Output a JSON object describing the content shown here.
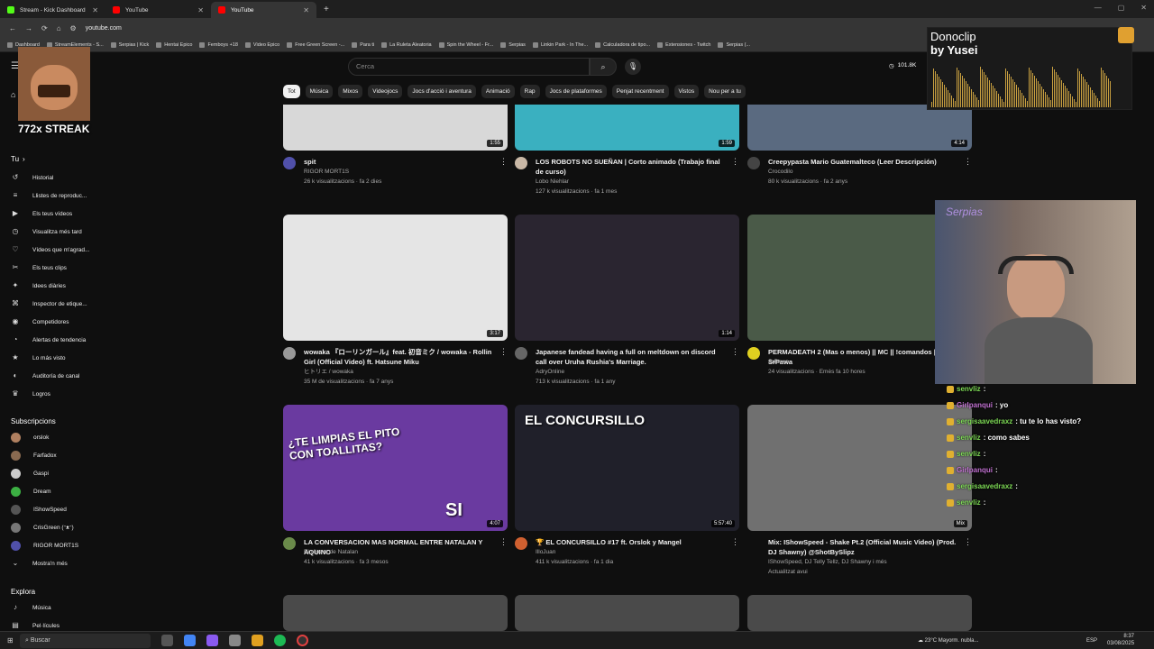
{
  "browser": {
    "tabs": [
      {
        "title": "Stream - Kick Dashboard",
        "icon_color": "#53fc18"
      },
      {
        "title": "YouTube",
        "icon_color": "#ff0000"
      },
      {
        "title": "YouTube",
        "icon_color": "#ff0000"
      }
    ],
    "new_tab": "+",
    "url": "youtube.com",
    "bookmarks": [
      "Dashboard",
      "StreamElements - S...",
      "Serpias | Kick",
      "Hentai Epico",
      "Femboys +18",
      "Video Epico",
      "Free Green Screen -...",
      "Para ti",
      "La Ruleta Aleatoria",
      "Spin the Wheel - Fr...",
      "Serpias",
      "Linkin Park - In The...",
      "Calculadora de tipo...",
      "Extensiones - Twitch",
      "Serpias (..."
    ]
  },
  "youtube": {
    "search_placeholder": "Cerca",
    "sub_count": "101.8K",
    "chips": [
      "Tot",
      "Música",
      "Mixos",
      "Videojocs",
      "Jocs d'acció i aventura",
      "Animació",
      "Rap",
      "Jocs de plataformes",
      "Penjat recentment",
      "Vistos",
      "Nou per a tu"
    ],
    "sidebar": {
      "tu_header": "Tu",
      "tu_items": [
        {
          "label": "Historial",
          "icon": "history-icon"
        },
        {
          "label": "Llistes de reproduc...",
          "icon": "playlist-icon"
        },
        {
          "label": "Els teus vídeos",
          "icon": "video-icon"
        },
        {
          "label": "Visualitza més tard",
          "icon": "clock-icon"
        },
        {
          "label": "Vídeos que m'agrad...",
          "icon": "like-icon"
        },
        {
          "label": "Els teus clips",
          "icon": "scissors-icon"
        },
        {
          "label": "Idees diàries",
          "icon": "bulb-icon"
        },
        {
          "label": "Inspector de etique...",
          "icon": "tag-icon"
        },
        {
          "label": "Competidores",
          "icon": "people-icon"
        },
        {
          "label": "Alertas de tendencia",
          "icon": "bell-icon"
        },
        {
          "label": "Lo más visto",
          "icon": "star-icon"
        },
        {
          "label": "Auditoría de canal",
          "icon": "audit-icon"
        },
        {
          "label": "Logros",
          "icon": "trophy-icon"
        }
      ],
      "subs_header": "Subscripcions",
      "subs": [
        {
          "label": "orslok",
          "color": "#b08060"
        },
        {
          "label": "Farfadox",
          "color": "#8a6a50"
        },
        {
          "label": "Gaspi",
          "color": "#ccc"
        },
        {
          "label": "Dream",
          "color": "#3cb043"
        },
        {
          "label": "IShowSpeed",
          "color": "#555"
        },
        {
          "label": "CrisGreen (ᵔᴥᵔ)",
          "color": "#777"
        },
        {
          "label": "RIGOR MORT1S",
          "color": "#5050aa"
        }
      ],
      "show_more": "Mostra'n més",
      "explore_header": "Explora",
      "explore": [
        {
          "label": "Música",
          "icon": "music-icon"
        },
        {
          "label": "Pel·lícules",
          "icon": "film-icon"
        }
      ]
    },
    "videos": [
      {
        "title": "spit",
        "channel": "RIGOR MORT1S",
        "meta": "26 k visualitzacions · fa 2 dies",
        "duration": "1:55",
        "thumb": "#d8d8d8",
        "avatar": "#5050aa"
      },
      {
        "title": "LOS ROBOTS NO SUEÑAN | Corto animado (Trabajo final de curso)",
        "channel": "Lobo Niehlar",
        "meta": "127 k visualitzacions · fa 1 mes",
        "duration": "1:59",
        "thumb": "#3ab0c0",
        "avatar": "#c9b8a6"
      },
      {
        "title": "Creepypasta Mario Guatemalteco (Leer Descripción)",
        "channel": "Crocodilo",
        "meta": "80 k visualitzacions · fa 2 anys",
        "duration": "4:14",
        "thumb": "#5a6a80",
        "avatar": "#444"
      },
      {
        "title": "wowaka 『ローリンガール』feat. 初音ミク / wowaka - Rollin Girl (Official Video) ft. Hatsune Miku",
        "channel": "ヒトリエ / wowaka",
        "meta": "35 M de visualitzacions · fa 7 anys",
        "duration": "3:17",
        "thumb": "#e5e5e5",
        "avatar": "#999"
      },
      {
        "title": "Japanese fandead having a full on meltdown on discord call over Uruha Rushia's Marriage.",
        "channel": "AdryOnline",
        "meta": "713 k visualitzacions · fa 1 any",
        "duration": "1:14",
        "thumb": "#2a2530",
        "avatar": "#666"
      },
      {
        "title": "PERMADEATH 2 (Mas o menos) || MC || !comandos || SrPawa",
        "channel": "SrPawa",
        "meta": "24 visualitzacions · Emès fa 10 hores",
        "duration": "",
        "thumb": "#4a5a48",
        "avatar": "#e0d020"
      },
      {
        "title": "LA CONVERSACION MAS NORMAL ENTRE NATALAN Y AQUINO",
        "channel": "El clipero de Natalan",
        "meta": "41 k visualitzacions · fa 3 mesos",
        "duration": "4:07",
        "thumb": "#6a3aa0",
        "avatar": "#6a8a4a"
      },
      {
        "title": "🏆 EL CONCURSILLO #17 ft. Orslok y Mangel",
        "channel": "IlloJuan",
        "meta": "411 k visualitzacions · fa 1 dia",
        "duration": "5:57:40",
        "thumb": "#20202a",
        "avatar": "#d06030"
      },
      {
        "title": "Mix: IShowSpeed - Shake Pt.2 (Official Music Video) (Prod. DJ Shawny) @ShotBySlipz",
        "channel": "IShowSpeed, DJ Telly Tellz, DJ Shawny i més",
        "meta": "Actualitzat avui",
        "duration": "Mix",
        "thumb": "#707070",
        "avatar": ""
      }
    ],
    "thumb_texts": [
      "¿TE LIMPIAS EL PITO CON TOALLITAS?",
      "SI",
      "EL CONCURSILLO"
    ]
  },
  "overlays": {
    "streak": "772x STREAK",
    "donoclip_title": "Donoclip",
    "donoclip_by": "by Yusei",
    "webcam_sign": "Serpias",
    "chat": [
      {
        "user": "senvliz",
        "msg": ":",
        "color": "#7cd854"
      },
      {
        "user": "Girlpanqui",
        "msg": ": yo",
        "color": "#c070d0"
      },
      {
        "user": "sergisaavedraxz",
        "msg": ": tu te lo has visto?",
        "color": "#7cd854"
      },
      {
        "user": "senvliz",
        "msg": ": como sabes",
        "color": "#7cd854"
      },
      {
        "user": "senvliz",
        "msg": ":",
        "color": "#7cd854"
      },
      {
        "user": "Girlpanqui",
        "msg": ":",
        "color": "#c070d0"
      },
      {
        "user": "sergisaavedraxz",
        "msg": ":",
        "color": "#7cd854"
      },
      {
        "user": "senvliz",
        "msg": ":",
        "color": "#7cd854"
      }
    ]
  },
  "taskbar": {
    "search": "Buscar",
    "weather": "23°C Mayorm. nubla...",
    "lang": "ESP",
    "time": "8:37",
    "date": "03/08/2025"
  }
}
